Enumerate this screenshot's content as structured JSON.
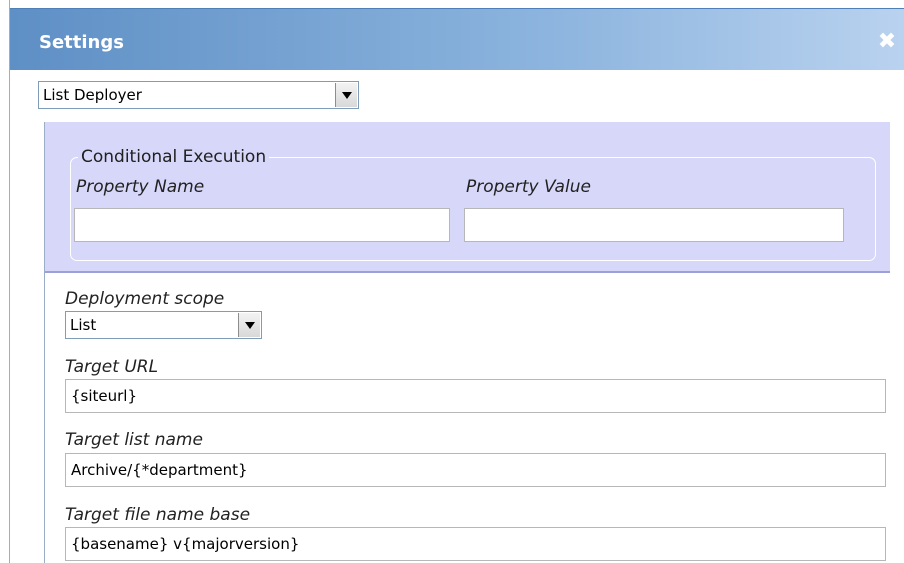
{
  "dialog": {
    "title": "Settings",
    "close_icon": "close-icon"
  },
  "deployer_select": {
    "value": "List Deployer"
  },
  "conditional_execution": {
    "legend": "Conditional Execution",
    "property_name_label": "Property Name",
    "property_name_value": "",
    "property_value_label": "Property Value",
    "property_value_value": ""
  },
  "deployment_scope": {
    "label": "Deployment scope",
    "value": "List"
  },
  "target_url": {
    "label": "Target URL",
    "value": "{siteurl}"
  },
  "target_list_name": {
    "label": "Target list name",
    "value": "Archive/{*department}"
  },
  "target_file_name_base": {
    "label": "Target file name base",
    "value": "{basename} v{majorversion}"
  },
  "colors": {
    "titlebar": "#5e8fc5",
    "conditional_band": "#d7d7fa",
    "border": "#9aaec8"
  }
}
